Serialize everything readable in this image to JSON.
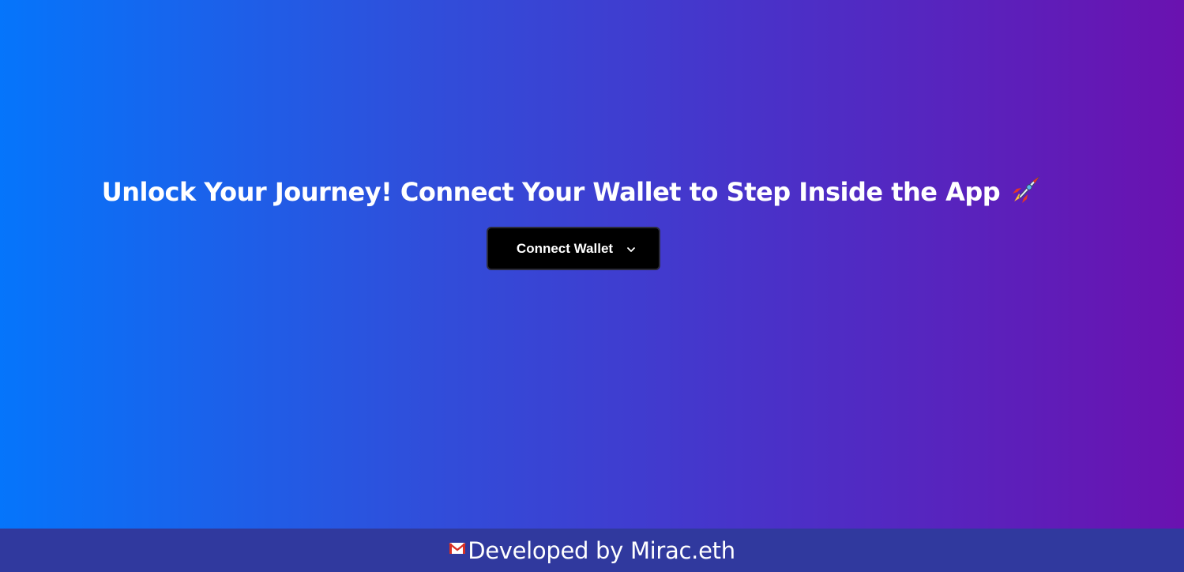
{
  "hero": {
    "headline": "Unlock Your Journey! Connect Your Wallet to Step Inside the App",
    "headline_icon": "rocket-icon"
  },
  "wallet": {
    "button_label": "Connect Wallet",
    "button_icon": "chevron-down-icon"
  },
  "footer": {
    "icon": "mail-icon",
    "credit": "Developed by Mirac.eth"
  },
  "colors": {
    "gradient_start": "#0575fb",
    "gradient_end": "#6a12b0",
    "footer_bg": "#30399e",
    "button_bg": "#000000",
    "text": "#ffffff"
  }
}
